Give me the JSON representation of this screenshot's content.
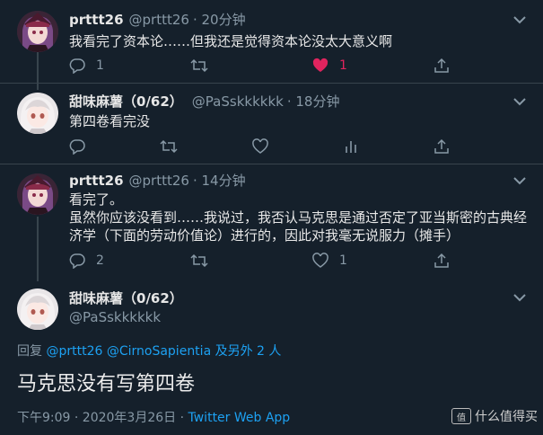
{
  "tweets": [
    {
      "name": "prttt26",
      "handle": "@prttt26",
      "time": "· 20分钟",
      "text": [
        "我看完了资本论……但我还是觉得资本论没太大意义啊"
      ],
      "replies": "1",
      "retweets": "",
      "likes": "1",
      "liked": true
    },
    {
      "name": "甜味麻薯（0/62）",
      "handle": "@PaSskkkkkk",
      "time": "· 18分钟",
      "text": [
        "第四卷看完没"
      ],
      "replies": "",
      "retweets": "",
      "likes": "",
      "liked": false
    },
    {
      "name": "prttt26",
      "handle": "@prttt26",
      "time": "· 14分钟",
      "text": [
        "看完了。",
        "虽然你应该没看到……我说过，我否认马克思是通过否定了亚当斯密的古典经",
        "济学（下面的劳动价值论）进行的，因此对我毫无说服力（摊手）"
      ],
      "replies": "2",
      "retweets": "",
      "likes": "1",
      "liked": false
    }
  ],
  "main": {
    "name": "甜味麻薯（0/62）",
    "handle": "@PaSskkkkkk",
    "reply_prefix": "回复",
    "reply_to_1": "@prttt26",
    "reply_to_2": "@CirnoSapientia",
    "reply_suffix": "及另外 2 人",
    "text": "马克思没有写第四卷",
    "timestamp": "下午9:09 · 2020年3月26日 · ",
    "source": "Twitter Web App"
  },
  "watermark": {
    "box": "值",
    "text": "什么值得买"
  },
  "colors": {
    "bg": "#15202b",
    "accent": "#1da1f2",
    "like": "#e0245e",
    "muted": "#8899a6"
  }
}
